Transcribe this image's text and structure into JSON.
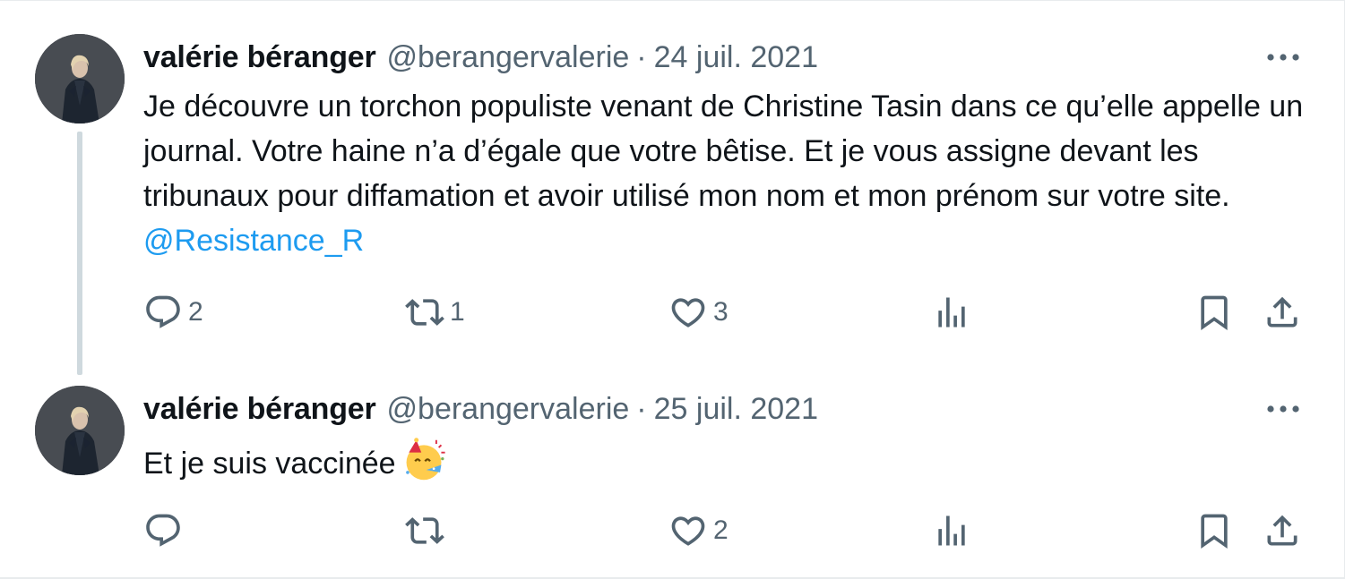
{
  "tweets": [
    {
      "author_name": "valérie béranger",
      "handle": "@berangervalerie",
      "separator": "·",
      "date": "24 juil. 2021",
      "text": "Je découvre un torchon populiste venant de Christine Tasin dans ce qu’elle appelle un journal. Votre haine n’a d’égale que votre bêtise. Et je vous assigne devant les tribunaux pour diffamation et avoir utilisé mon nom et mon prénom sur votre site.",
      "mention": "@Resistance_R",
      "counts": {
        "replies": "2",
        "retweets": "1",
        "likes": "3"
      }
    },
    {
      "author_name": "valérie béranger",
      "handle": "@berangervalerie",
      "separator": "·",
      "date": "25 juil. 2021",
      "text": "Et je suis vaccinée",
      "emoji": "partying-face-emoji",
      "counts": {
        "replies": "",
        "retweets": "",
        "likes": "2"
      }
    }
  ],
  "icons": {
    "reply": "reply-icon",
    "retweet": "retweet-icon",
    "like": "heart-icon",
    "views": "views-chart-icon",
    "bookmark": "bookmark-icon",
    "share": "share-icon",
    "more": "more-dots-icon"
  },
  "colors": {
    "text": "#0f1419",
    "secondary": "#536471",
    "mention": "#1d9bf0",
    "thread_line": "#cfd9de"
  }
}
